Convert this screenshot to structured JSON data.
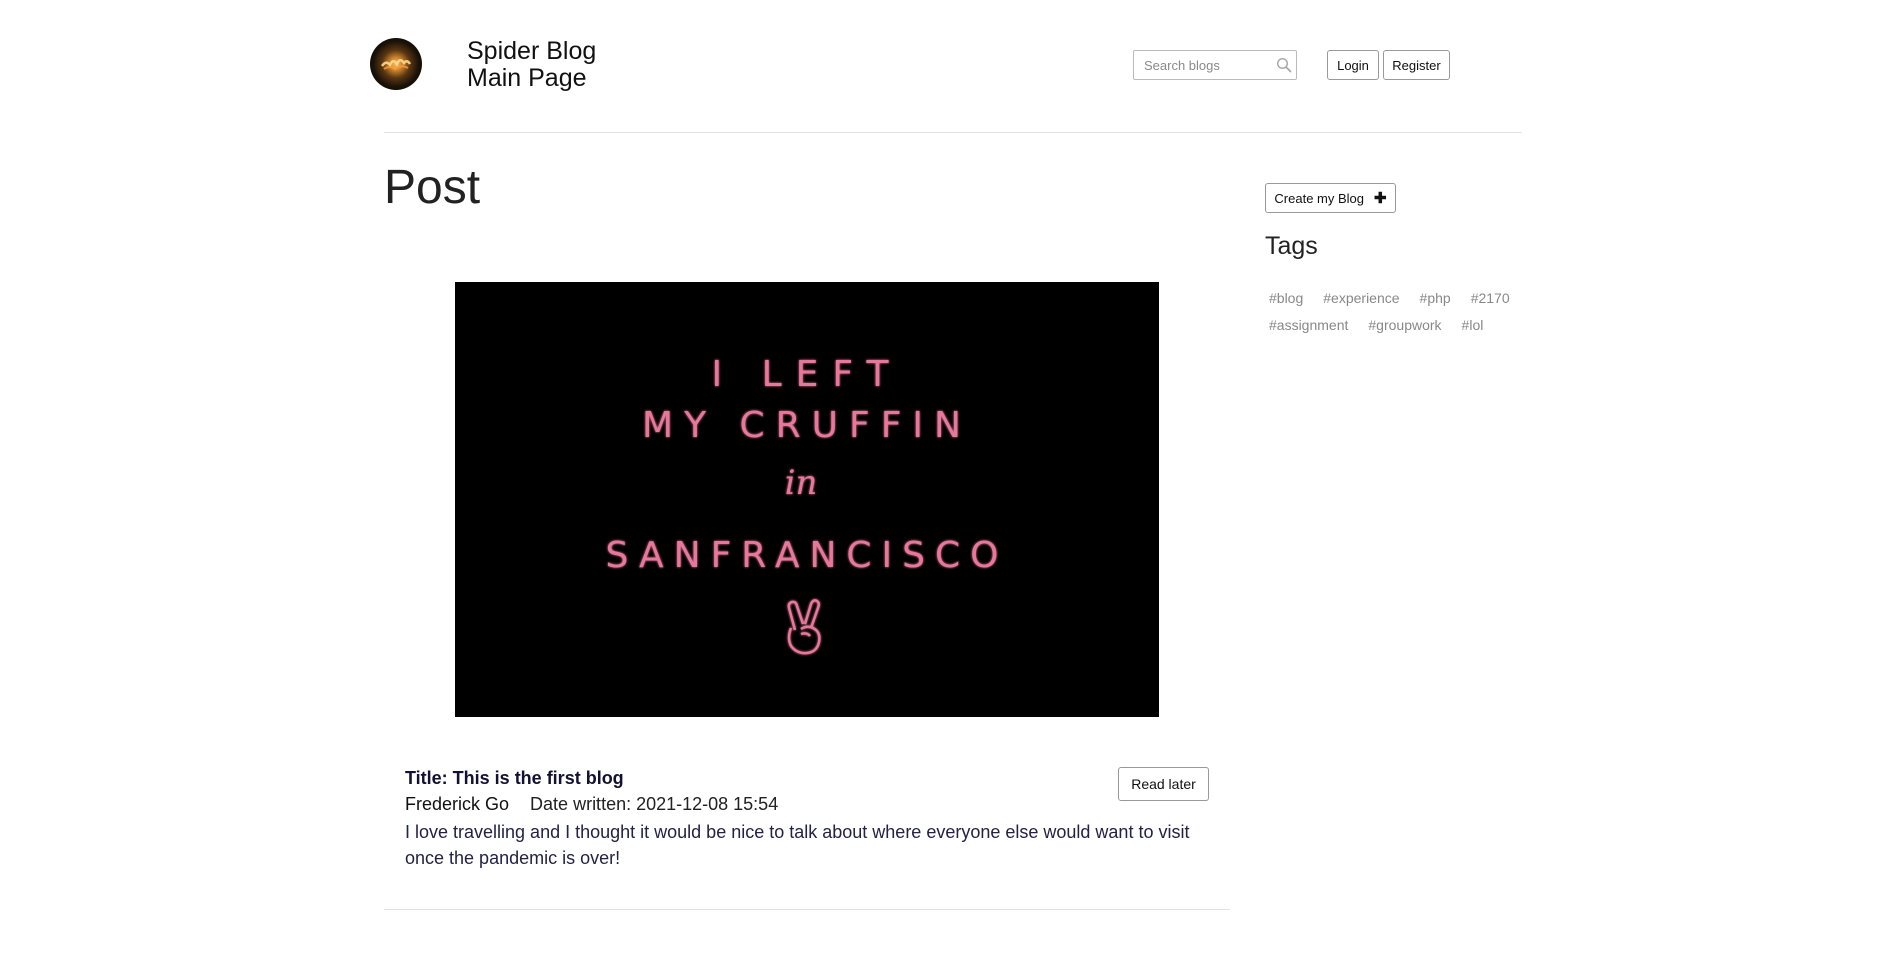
{
  "header": {
    "title_line1": "Spider Blog",
    "title_line2": "Main Page",
    "logo_icon": "blog-logo-icon",
    "search": {
      "placeholder": "Search blogs",
      "value": "",
      "icon": "search-icon"
    },
    "login_label": "Login",
    "register_label": "Register"
  },
  "main": {
    "page_title": "Post",
    "post": {
      "image_text": {
        "line1": "I LEFT",
        "line2": "MY CRUFFIN",
        "line3": "in",
        "line4": "SANFRANCISCO",
        "icon": "peace-hand-icon"
      },
      "title": "Title: This is the first blog",
      "author": "Frederick Go",
      "date": "Date written: 2021-12-08 15:54",
      "body": "I love travelling and I thought it would be nice to talk about where everyone else would want to visit once the pandemic is over!",
      "read_later_label": "Read later"
    }
  },
  "sidebar": {
    "create_blog_label": "Create my Blog",
    "create_blog_icon": "plus-icon",
    "tags_heading": "Tags",
    "tags": [
      "#blog",
      "#experience",
      "#php",
      "#2170",
      "#assignment",
      "#groupwork",
      "#lol"
    ]
  },
  "colors": {
    "neon_pink": "#e8789a",
    "title_navy": "#111133",
    "tag_gray": "#888888",
    "rule_gray": "#e2e2e2"
  }
}
